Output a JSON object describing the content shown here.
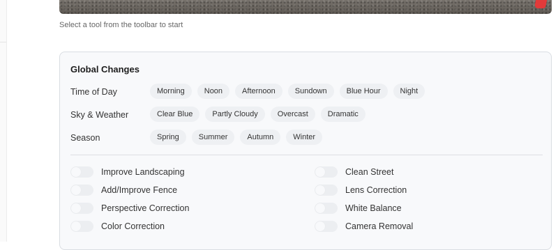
{
  "hint": "Select a tool from the toolbar to start",
  "panel": {
    "title": "Global Changes",
    "rows": [
      {
        "label": "Time of Day",
        "chips": [
          "Morning",
          "Noon",
          "Afternoon",
          "Sundown",
          "Blue Hour",
          "Night"
        ]
      },
      {
        "label": "Sky & Weather",
        "chips": [
          "Clear Blue",
          "Partly Cloudy",
          "Overcast",
          "Dramatic"
        ]
      },
      {
        "label": "Season",
        "chips": [
          "Spring",
          "Summer",
          "Autumn",
          "Winter"
        ]
      }
    ],
    "toggles_left": [
      {
        "label": "Improve Landscaping",
        "on": false
      },
      {
        "label": "Add/Improve Fence",
        "on": false
      },
      {
        "label": "Perspective Correction",
        "on": false
      },
      {
        "label": "Color Correction",
        "on": false
      }
    ],
    "toggles_right": [
      {
        "label": "Clean Street",
        "on": false
      },
      {
        "label": "Lens Correction",
        "on": false
      },
      {
        "label": "White Balance",
        "on": false
      },
      {
        "label": "Camera Removal",
        "on": false
      }
    ]
  }
}
